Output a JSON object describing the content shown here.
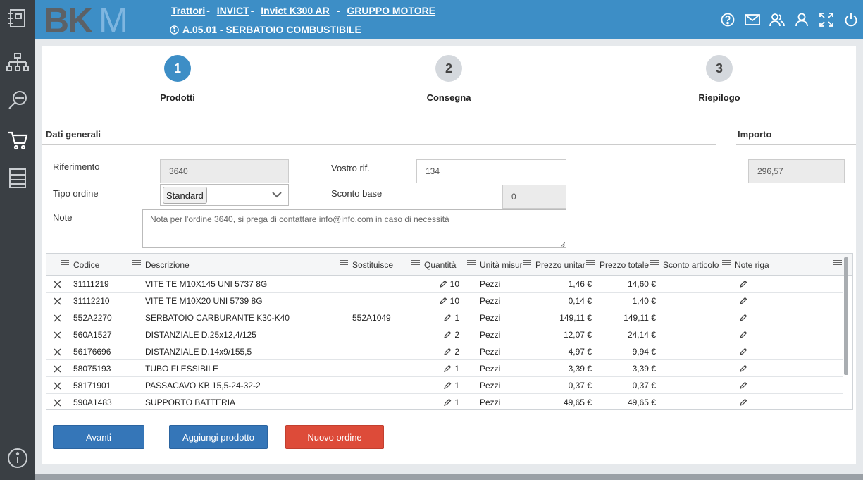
{
  "header": {
    "logo_text": "BKM",
    "breadcrumb": [
      {
        "label": "Trattori"
      },
      {
        "label": "INVICT"
      },
      {
        "label": "Invict K300 AR"
      },
      {
        "label": "GRUPPO MOTORE"
      }
    ],
    "breadcrumb_sep": "-",
    "subtitle": "A.05.01 - SERBATOIO COMBUSTIBILE",
    "icons": [
      "help-icon",
      "mail-icon",
      "users-icon",
      "user-icon",
      "fullscreen-icon",
      "power-icon"
    ]
  },
  "sidebar": {
    "items": [
      "catalog-icon",
      "hierarchy-icon",
      "search-icon",
      "cart-icon",
      "list-icon"
    ],
    "footer": "info-icon"
  },
  "steps": [
    {
      "num": "1",
      "label": "Prodotti",
      "active": true
    },
    {
      "num": "2",
      "label": "Consegna",
      "active": false
    },
    {
      "num": "3",
      "label": "Riepilogo",
      "active": false
    }
  ],
  "form": {
    "section_title": "Dati generali",
    "importo_title": "Importo",
    "riferimento_label": "Riferimento",
    "riferimento_value": "3640",
    "vostro_rif_label": "Vostro rif.",
    "vostro_rif_value": "134",
    "tipo_ordine_label": "Tipo ordine",
    "tipo_ordine_value": "Standard",
    "sconto_base_label": "Sconto base",
    "sconto_base_value": "0",
    "note_label": "Note",
    "note_value": "Nota per l'ordine 3640, si prega di contattare info@info.com in caso di necessità",
    "importo_value": "296,57"
  },
  "table": {
    "columns": [
      "Codice",
      "Descrizione",
      "Sostituisce",
      "Quantità",
      "Unità misura",
      "Prezzo unitario",
      "Prezzo totale",
      "Sconto articolo",
      "Note riga"
    ],
    "rows": [
      {
        "codice": "31111219",
        "descrizione": "VITE TE M10X145 UNI 5737 8G",
        "sostituisce": "",
        "quantita": "10",
        "unita": "Pezzi",
        "prezzo_unitario": "1,46 €",
        "prezzo_totale": "14,60 €",
        "sconto": ""
      },
      {
        "codice": "31112210",
        "descrizione": "VITE TE M10X20 UNI 5739 8G",
        "sostituisce": "",
        "quantita": "10",
        "unita": "Pezzi",
        "prezzo_unitario": "0,14 €",
        "prezzo_totale": "1,40 €",
        "sconto": ""
      },
      {
        "codice": "552A2270",
        "descrizione": "SERBATOIO CARBURANTE K30-K40",
        "sostituisce": "552A1049",
        "quantita": "1",
        "unita": "Pezzi",
        "prezzo_unitario": "149,11 €",
        "prezzo_totale": "149,11 €",
        "sconto": ""
      },
      {
        "codice": "560A1527",
        "descrizione": "DISTANZIALE D.25x12,4/125",
        "sostituisce": "",
        "quantita": "2",
        "unita": "Pezzi",
        "prezzo_unitario": "12,07 €",
        "prezzo_totale": "24,14 €",
        "sconto": ""
      },
      {
        "codice": "56176696",
        "descrizione": "DISTANZIALE D.14x9/155,5",
        "sostituisce": "",
        "quantita": "2",
        "unita": "Pezzi",
        "prezzo_unitario": "4,97 €",
        "prezzo_totale": "9,94 €",
        "sconto": ""
      },
      {
        "codice": "58075193",
        "descrizione": "TUBO FLESSIBILE",
        "sostituisce": "",
        "quantita": "1",
        "unita": "Pezzi",
        "prezzo_unitario": "3,39 €",
        "prezzo_totale": "3,39 €",
        "sconto": ""
      },
      {
        "codice": "58171901",
        "descrizione": "PASSACAVO KB 15,5-24-32-2",
        "sostituisce": "",
        "quantita": "1",
        "unita": "Pezzi",
        "prezzo_unitario": "0,37 €",
        "prezzo_totale": "0,37 €",
        "sconto": ""
      },
      {
        "codice": "590A1483",
        "descrizione": "SUPPORTO BATTERIA",
        "sostituisce": "",
        "quantita": "1",
        "unita": "Pezzi",
        "prezzo_unitario": "49,65 €",
        "prezzo_totale": "49,65 €",
        "sconto": ""
      }
    ]
  },
  "buttons": {
    "avanti": "Avanti",
    "aggiungi": "Aggiungi prodotto",
    "nuovo": "Nuovo ordine"
  },
  "colors": {
    "primary": "#3d8ec6",
    "sidebar": "#3a3f44",
    "button_blue": "#3576b8",
    "button_red": "#dd4b39"
  }
}
